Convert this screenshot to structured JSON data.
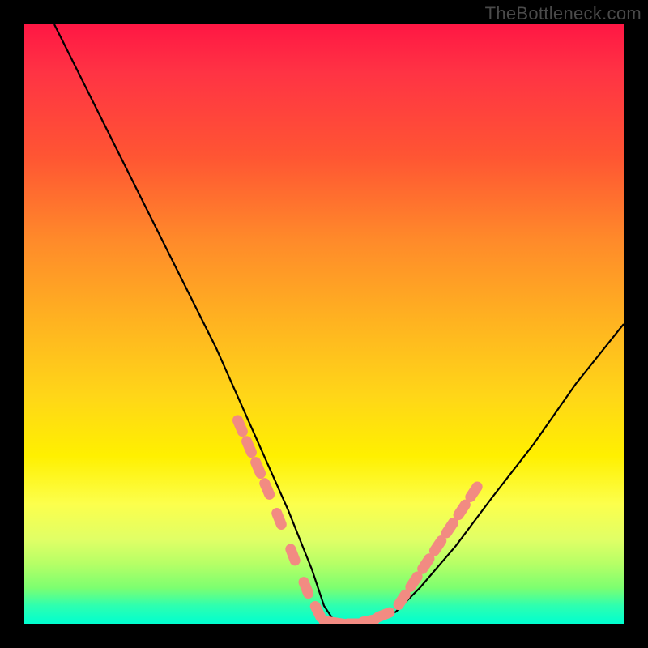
{
  "watermark": {
    "text": "TheBottleneck.com"
  },
  "chart_data": {
    "type": "line",
    "title": "",
    "xlabel": "",
    "ylabel": "",
    "xlim": [
      0,
      100
    ],
    "ylim": [
      0,
      100
    ],
    "grid": false,
    "legend": false,
    "background": "rainbow-gradient-vertical",
    "series": [
      {
        "name": "bottleneck-curve",
        "x": [
          5,
          8,
          12,
          17,
          22,
          27,
          32,
          36,
          40,
          44,
          48,
          50,
          52,
          55,
          58,
          62,
          66,
          72,
          78,
          85,
          92,
          100
        ],
        "y": [
          100,
          94,
          86,
          76,
          66,
          56,
          46,
          37,
          28,
          19,
          9,
          3,
          0,
          0,
          0,
          2,
          6,
          13,
          21,
          30,
          40,
          50
        ]
      }
    ],
    "markers": [
      {
        "name": "left-branch-dots",
        "color": "#f28b82",
        "x": [
          36.0,
          37.5,
          39.0,
          40.5,
          42.5,
          44.8,
          47.0,
          49.0
        ],
        "y": [
          33.0,
          29.5,
          26.0,
          22.5,
          17.5,
          11.5,
          6.0,
          2.0
        ]
      },
      {
        "name": "bottom-dots",
        "color": "#f28b82",
        "x": [
          51.0,
          53.0,
          55.0,
          57.5,
          60.0
        ],
        "y": [
          0.3,
          0.0,
          0.0,
          0.5,
          1.5
        ]
      },
      {
        "name": "right-branch-dots",
        "color": "#f28b82",
        "x": [
          63.0,
          65.0,
          67.0,
          69.0,
          71.0,
          73.0,
          75.0
        ],
        "y": [
          4.0,
          7.0,
          10.0,
          13.0,
          16.0,
          19.0,
          22.0
        ]
      }
    ]
  }
}
